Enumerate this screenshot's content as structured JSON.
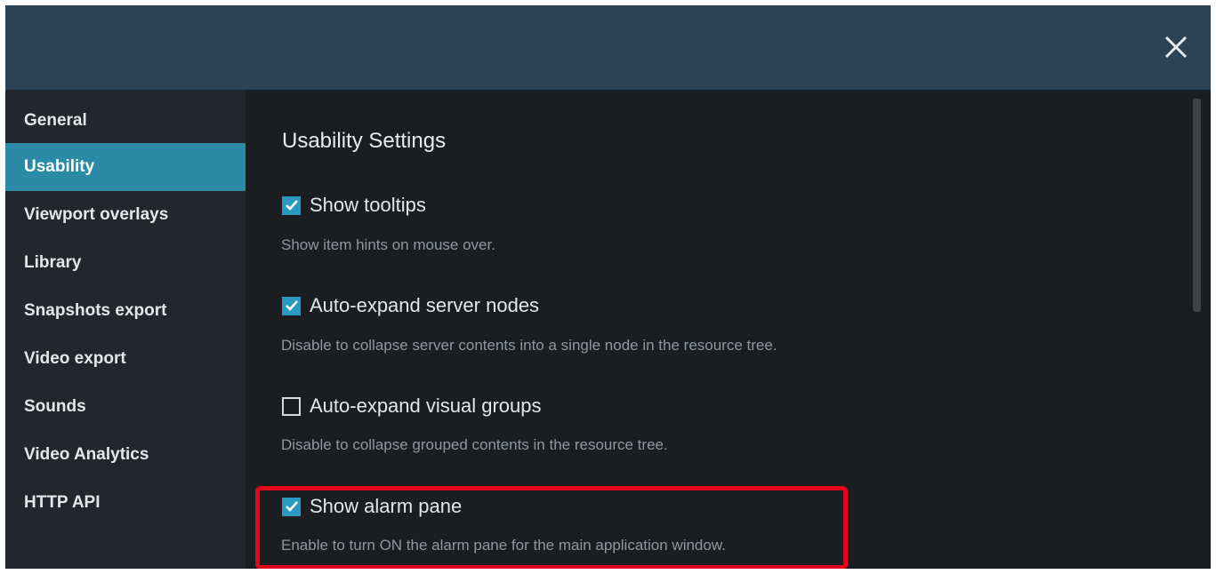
{
  "window": {
    "close_icon": "close-icon"
  },
  "sidebar": {
    "items": [
      {
        "label": "General",
        "active": false
      },
      {
        "label": "Usability",
        "active": true
      },
      {
        "label": "Viewport overlays",
        "active": false
      },
      {
        "label": "Library",
        "active": false
      },
      {
        "label": "Snapshots export",
        "active": false
      },
      {
        "label": "Video export",
        "active": false
      },
      {
        "label": "Sounds",
        "active": false
      },
      {
        "label": "Video Analytics",
        "active": false
      },
      {
        "label": "HTTP API",
        "active": false
      }
    ]
  },
  "main": {
    "title": "Usability Settings",
    "options": [
      {
        "label": "Show tooltips",
        "checked": true,
        "description": "Show item hints on mouse over."
      },
      {
        "label": "Auto-expand server nodes",
        "checked": true,
        "description": "Disable to collapse server contents into a single node in the resource tree."
      },
      {
        "label": "Auto-expand visual groups",
        "checked": false,
        "description": "Disable to collapse grouped contents in the resource tree."
      },
      {
        "label": "Show alarm pane",
        "checked": true,
        "description": "Enable to turn ON the alarm pane for the main application window."
      }
    ]
  },
  "colors": {
    "titlebar": "#2c4255",
    "accent": "#2b8aa6",
    "checkbox": "#2b9ac2",
    "highlight": "#e2061c"
  }
}
